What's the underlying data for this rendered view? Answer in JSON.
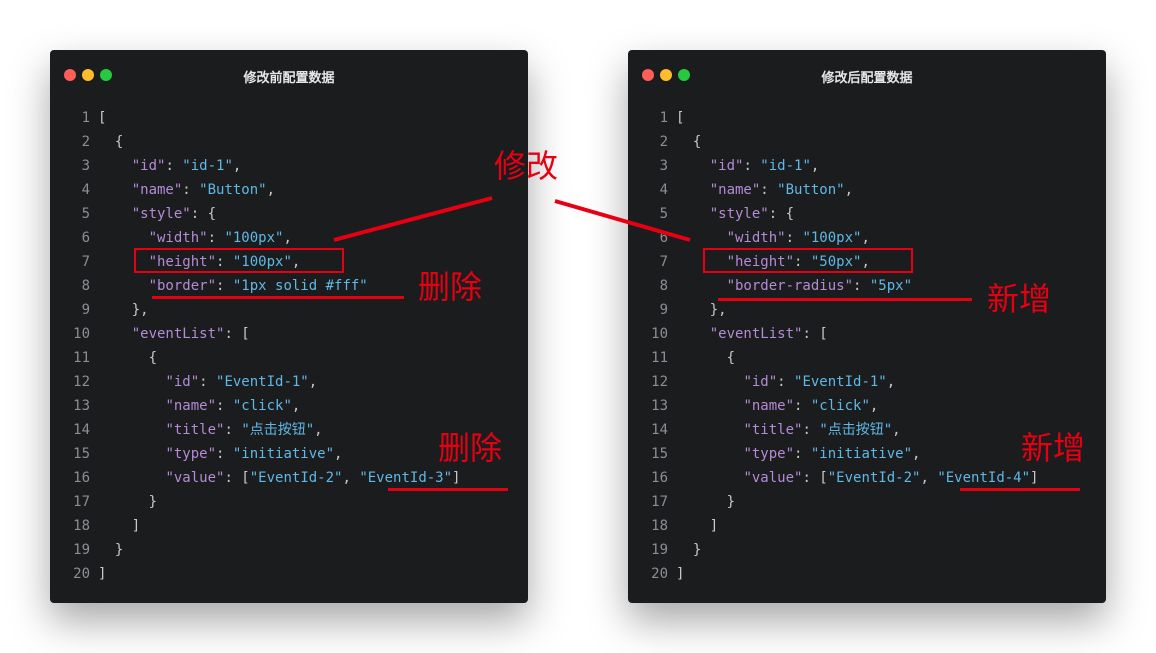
{
  "windows": [
    {
      "id": "before",
      "title": "修改前配置数据",
      "lines": [
        {
          "n": "1",
          "t": "["
        },
        {
          "n": "2",
          "t": "  {"
        },
        {
          "n": "3",
          "t": "    \"id\": \"id-1\","
        },
        {
          "n": "4",
          "t": "    \"name\": \"Button\","
        },
        {
          "n": "5",
          "t": "    \"style\": {"
        },
        {
          "n": "6",
          "t": "      \"width\": \"100px\","
        },
        {
          "n": "7",
          "t": "      \"height\": \"100px\","
        },
        {
          "n": "8",
          "t": "      \"border\": \"1px solid #fff\""
        },
        {
          "n": "9",
          "t": "    },"
        },
        {
          "n": "10",
          "t": "    \"eventList\": ["
        },
        {
          "n": "11",
          "t": "      {"
        },
        {
          "n": "12",
          "t": "        \"id\": \"EventId-1\","
        },
        {
          "n": "13",
          "t": "        \"name\": \"click\","
        },
        {
          "n": "14",
          "t": "        \"title\": \"点击按钮\","
        },
        {
          "n": "15",
          "t": "        \"type\": \"initiative\","
        },
        {
          "n": "16",
          "t": "        \"value\": [\"EventId-2\", \"EventId-3\"]"
        },
        {
          "n": "17",
          "t": "      }"
        },
        {
          "n": "18",
          "t": "    ]"
        },
        {
          "n": "19",
          "t": "  }"
        },
        {
          "n": "20",
          "t": "]"
        }
      ]
    },
    {
      "id": "after",
      "title": "修改后配置数据",
      "lines": [
        {
          "n": "1",
          "t": "["
        },
        {
          "n": "2",
          "t": "  {"
        },
        {
          "n": "3",
          "t": "    \"id\": \"id-1\","
        },
        {
          "n": "4",
          "t": "    \"name\": \"Button\","
        },
        {
          "n": "5",
          "t": "    \"style\": {"
        },
        {
          "n": "6",
          "t": "      \"width\": \"100px\","
        },
        {
          "n": "7",
          "t": "      \"height\": \"50px\","
        },
        {
          "n": "8",
          "t": "      \"border-radius\": \"5px\""
        },
        {
          "n": "9",
          "t": "    },"
        },
        {
          "n": "10",
          "t": "    \"eventList\": ["
        },
        {
          "n": "11",
          "t": "      {"
        },
        {
          "n": "12",
          "t": "        \"id\": \"EventId-1\","
        },
        {
          "n": "13",
          "t": "        \"name\": \"click\","
        },
        {
          "n": "14",
          "t": "        \"title\": \"点击按钮\","
        },
        {
          "n": "15",
          "t": "        \"type\": \"initiative\","
        },
        {
          "n": "16",
          "t": "        \"value\": [\"EventId-2\", \"EventId-4\"]"
        },
        {
          "n": "17",
          "t": "      }"
        },
        {
          "n": "18",
          "t": "    ]"
        },
        {
          "n": "19",
          "t": "  }"
        },
        {
          "n": "20",
          "t": "]"
        }
      ]
    }
  ],
  "annotations": {
    "modify": "修改",
    "delete_1": "删除",
    "delete_2": "删除",
    "add_1": "新增",
    "add_2": "新增"
  },
  "colors": {
    "annotation": "#e60012",
    "key": "#b58bd6",
    "string": "#5fb8e6",
    "window_bg": "#1b1c1e",
    "line_number": "#8a8f96"
  }
}
